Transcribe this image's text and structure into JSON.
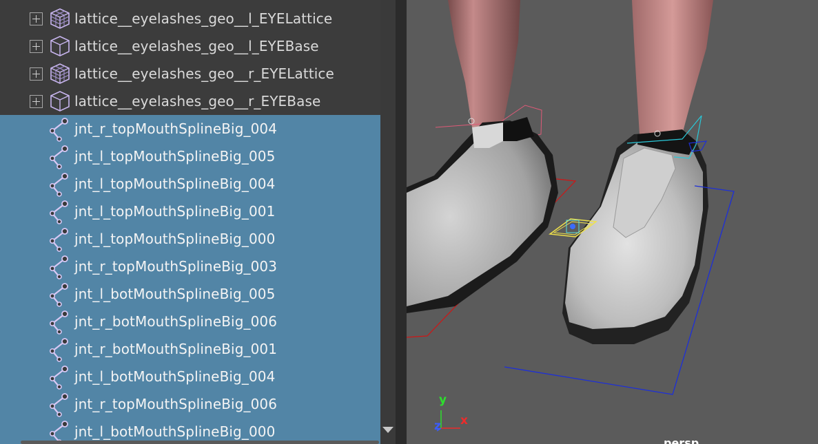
{
  "outliner": {
    "rows": [
      {
        "label": "lattice__eyelashes_geo__l_EYELattice",
        "icon": "lattice-icon",
        "selected": false,
        "expandable": true
      },
      {
        "label": "lattice__eyelashes_geo__l_EYEBase",
        "icon": "lattice-base-icon",
        "selected": false,
        "expandable": true
      },
      {
        "label": "lattice__eyelashes_geo__r_EYELattice",
        "icon": "lattice-icon",
        "selected": false,
        "expandable": true
      },
      {
        "label": "lattice__eyelashes_geo__r_EYEBase",
        "icon": "lattice-base-icon",
        "selected": false,
        "expandable": true
      },
      {
        "label": "jnt_r_topMouthSplineBig_004",
        "icon": "joint-icon",
        "selected": true,
        "expandable": false
      },
      {
        "label": "jnt_l_topMouthSplineBig_005",
        "icon": "joint-icon",
        "selected": true,
        "expandable": false
      },
      {
        "label": "jnt_l_topMouthSplineBig_004",
        "icon": "joint-icon",
        "selected": true,
        "expandable": false
      },
      {
        "label": "jnt_l_topMouthSplineBig_001",
        "icon": "joint-icon",
        "selected": true,
        "expandable": false
      },
      {
        "label": "jnt_l_topMouthSplineBig_000",
        "icon": "joint-icon",
        "selected": true,
        "expandable": false
      },
      {
        "label": "jnt_r_topMouthSplineBig_003",
        "icon": "joint-icon",
        "selected": true,
        "expandable": false
      },
      {
        "label": "jnt_l_botMouthSplineBig_005",
        "icon": "joint-icon",
        "selected": true,
        "expandable": false
      },
      {
        "label": "jnt_r_botMouthSplineBig_006",
        "icon": "joint-icon",
        "selected": true,
        "expandable": false
      },
      {
        "label": "jnt_r_botMouthSplineBig_001",
        "icon": "joint-icon",
        "selected": true,
        "expandable": false
      },
      {
        "label": "jnt_l_botMouthSplineBig_004",
        "icon": "joint-icon",
        "selected": true,
        "expandable": false
      },
      {
        "label": "jnt_r_topMouthSplineBig_006",
        "icon": "joint-icon",
        "selected": true,
        "expandable": false
      },
      {
        "label": "jnt_l_botMouthSplineBig_000",
        "icon": "joint-icon",
        "selected": true,
        "expandable": false
      }
    ]
  },
  "viewport": {
    "axis": {
      "x": "x",
      "y": "y",
      "z": "z"
    },
    "camera_label": "persp",
    "colors": {
      "selection": "#5285a6",
      "axis_x": "#ee2b2b",
      "axis_y": "#2ddf2d",
      "axis_z": "#3b5cff"
    }
  }
}
